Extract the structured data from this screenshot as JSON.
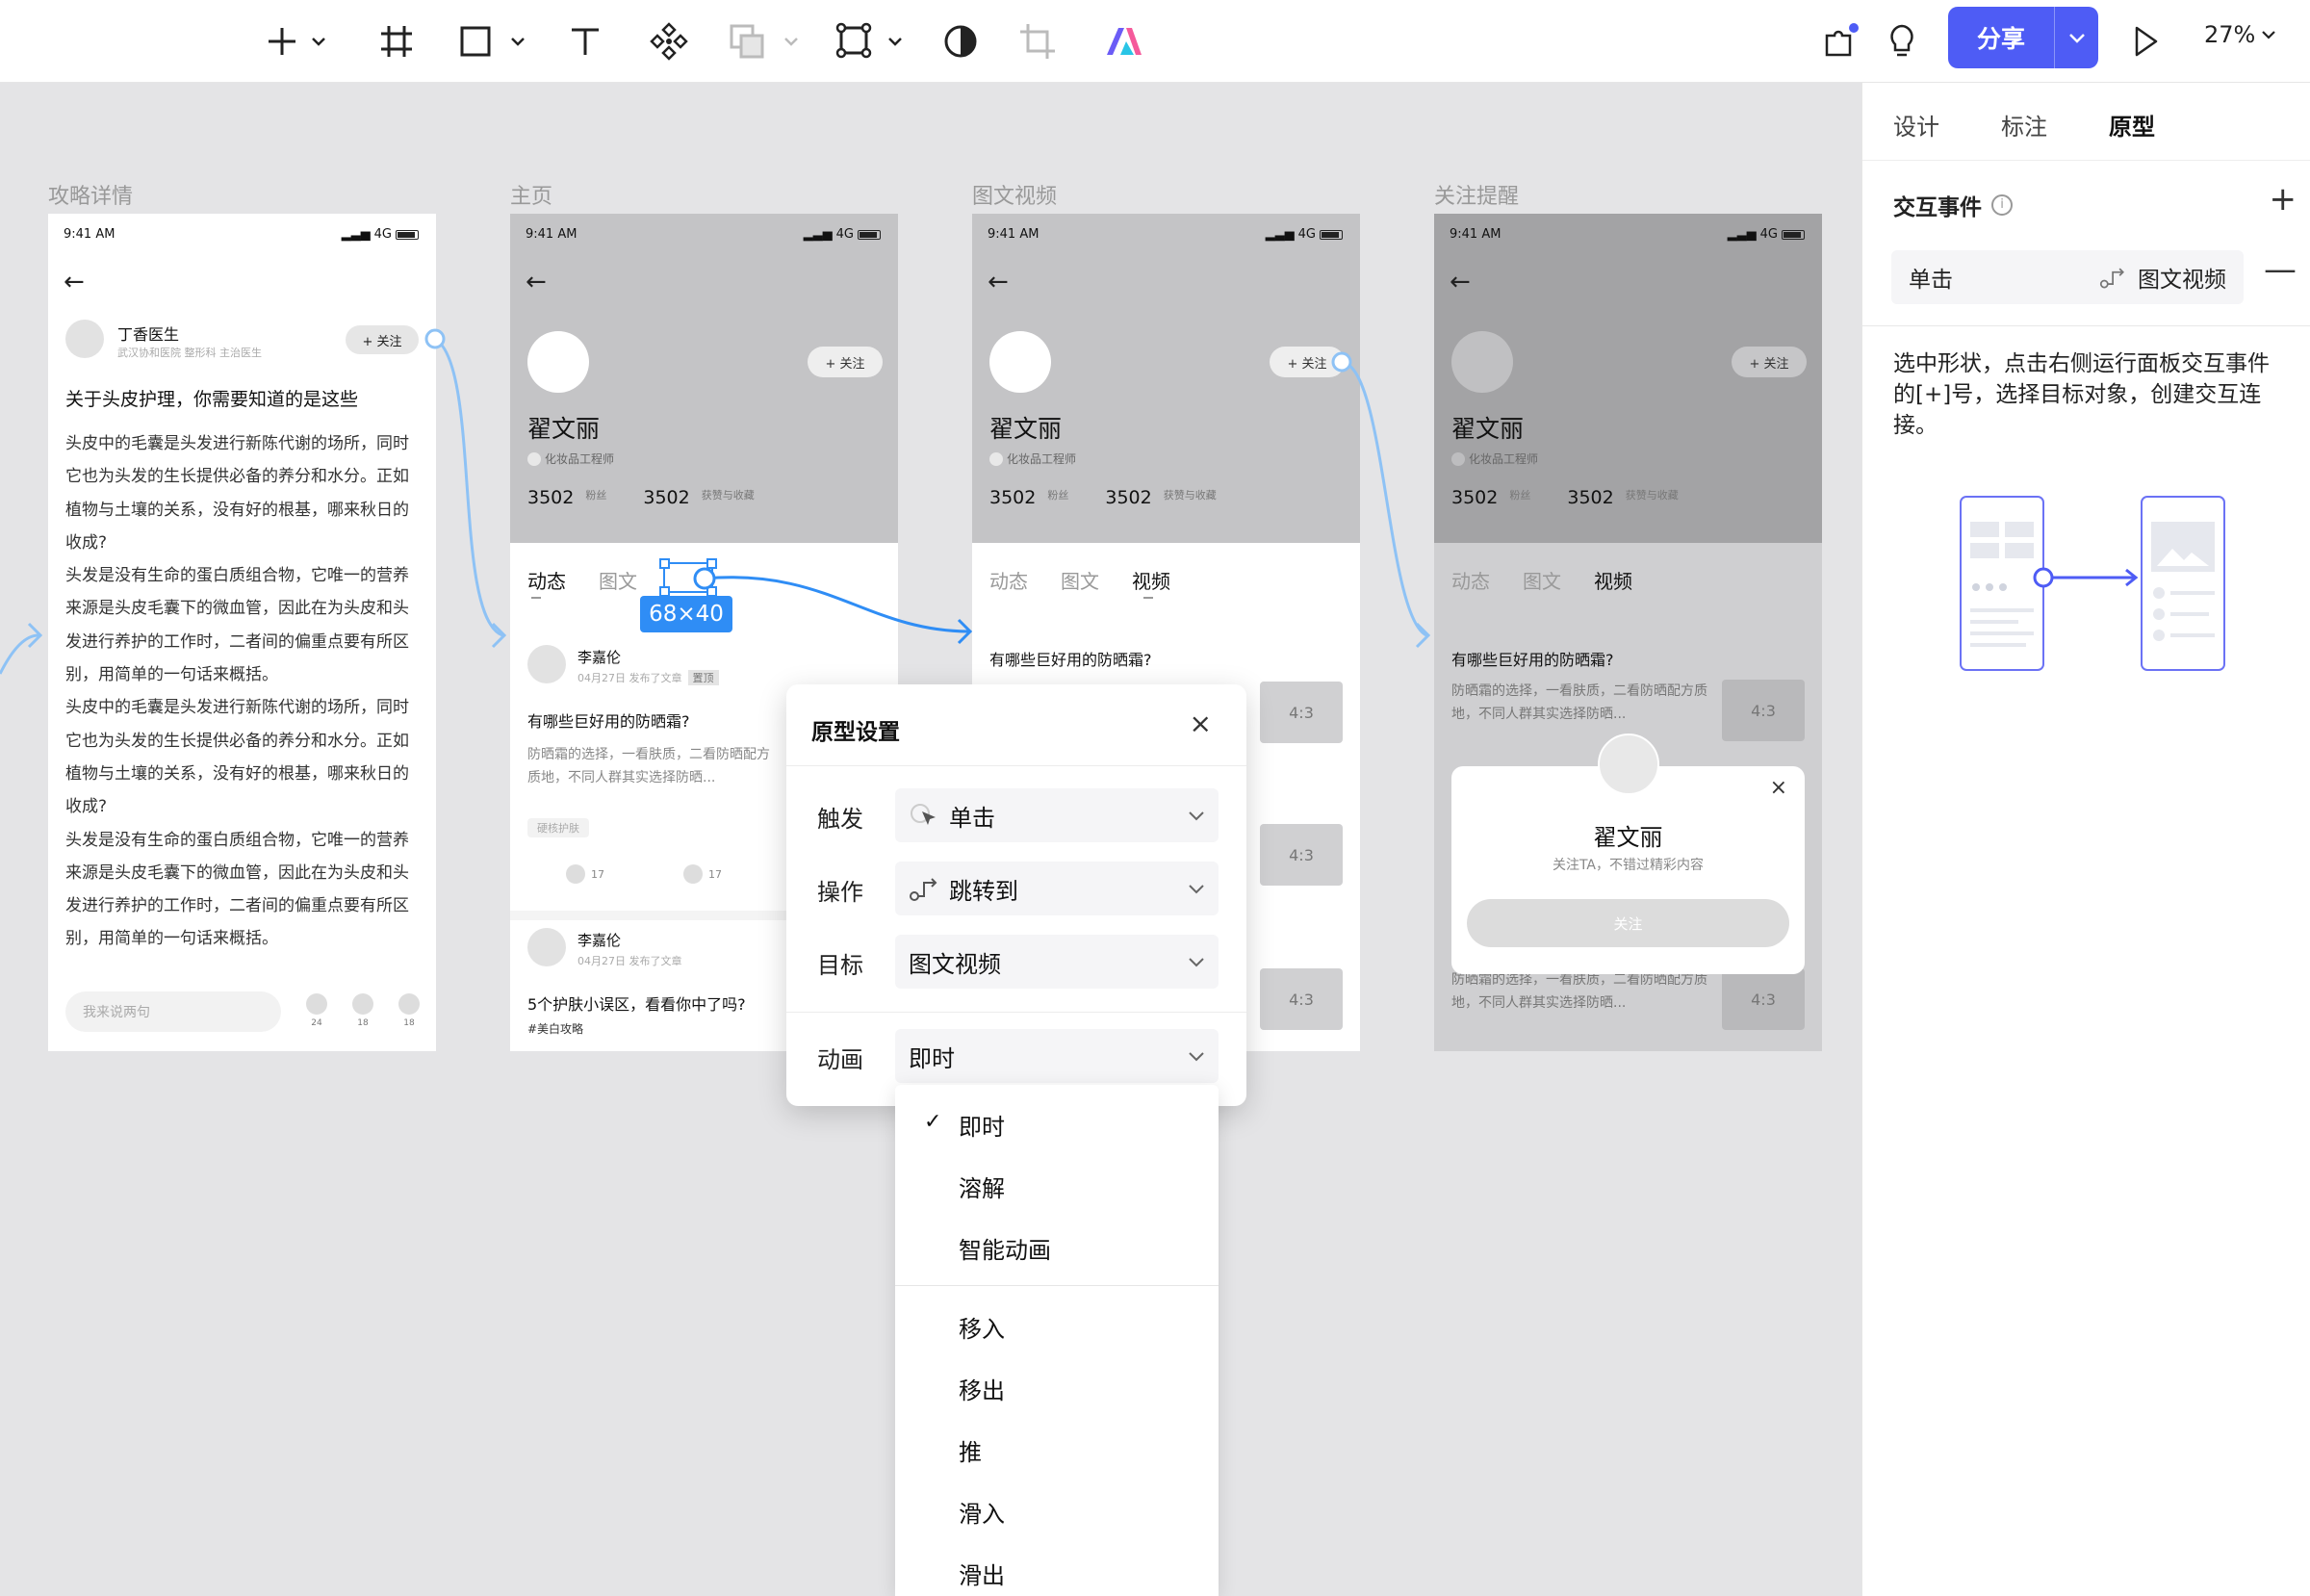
{
  "toolbar": {
    "tools": [
      "add",
      "frame",
      "rectangle",
      "text",
      "component",
      "boolean",
      "vector",
      "mask",
      "crop",
      "plugin"
    ],
    "share_label": "分享",
    "zoom": "27%"
  },
  "right_panel": {
    "tabs": [
      "设计",
      "标注",
      "原型"
    ],
    "active_tab": "原型",
    "section_title": "交互事件",
    "event": {
      "trigger": "单击",
      "target": "图文视频"
    },
    "hint": "选中形状，点击右侧运行面板交互事件的[+]号，选择目标对象，创建交互连接。"
  },
  "frames": [
    {
      "title": "攻略详情"
    },
    {
      "title": "主页"
    },
    {
      "title": "图文视频"
    },
    {
      "title": "关注提醒"
    }
  ],
  "status": {
    "time": "9:41 AM",
    "network": "4G"
  },
  "article": {
    "author": "丁香医生",
    "author_sub": "武汉协和医院 整形科 主治医生",
    "follow": "+ 关注",
    "title": "关于头皮护理，你需要知道的是这些",
    "paragraphs": [
      "头皮中的毛囊是头发进行新陈代谢的场所，同时它也为头发的生长提供必备的养分和水分。正如植物与土壤的关系，没有好的根基，哪来秋日的收成?",
      "头发是没有生命的蛋白质组合物，它唯一的营养来源是头皮毛囊下的微血管，因此在为头皮和头发进行养护的工作时，二者间的偏重点要有所区别，用简单的一句话来概括。",
      "头皮中的毛囊是头发进行新陈代谢的场所，同时它也为头发的生长提供必备的养分和水分。正如植物与土壤的关系，没有好的根基，哪来秋日的收成?",
      "头发是没有生命的蛋白质组合物，它唯一的营养来源是头皮毛囊下的微血管，因此在为头皮和头发进行养护的工作时，二者间的偏重点要有所区别，用简单的一句话来概括。"
    ],
    "comment_placeholder": "我来说两句",
    "counts": [
      "24",
      "18",
      "18"
    ]
  },
  "profile": {
    "name": "翟文丽",
    "role": "化妆品工程师",
    "fans": "3502",
    "fans_label": "粉丝",
    "likes": "3502",
    "likes_label": "获赞与收藏",
    "follow": "+ 关注",
    "tabs": [
      "动态",
      "图文",
      "视频"
    ]
  },
  "feed": {
    "user": "李嘉伦",
    "date": "04月27日 发布了文章",
    "pinned": "置顶",
    "q1": "有哪些巨好用的防晒霜?",
    "q1_body": "防晒霜的选择，一看肤质，二看防晒配方质地，不同人群其实选择防晒...",
    "tag": "硬核护肤",
    "likes": "17",
    "comments": "17",
    "q2": "5个护肤小误区，看看你中了吗?",
    "q2_tag": "#美白攻略",
    "ratio": "4:3"
  },
  "follow_modal": {
    "name": "翟文丽",
    "sub": "关注TA，不错过精彩内容",
    "button": "关注"
  },
  "size_badge": "68×40",
  "prototype_settings": {
    "title": "原型设置",
    "trigger_label": "触发",
    "trigger_value": "单击",
    "action_label": "操作",
    "action_value": "跳转到",
    "target_label": "目标",
    "target_value": "图文视频",
    "animation_label": "动画",
    "animation_value": "即时"
  },
  "animation_options": [
    "即时",
    "溶解",
    "智能动画",
    "移入",
    "移出",
    "推",
    "滑入",
    "滑出"
  ],
  "selected_animation": "即时",
  "colors": {
    "accent": "#4e5cf5",
    "link": "#8ec2f5",
    "selection": "#2f8df5"
  }
}
